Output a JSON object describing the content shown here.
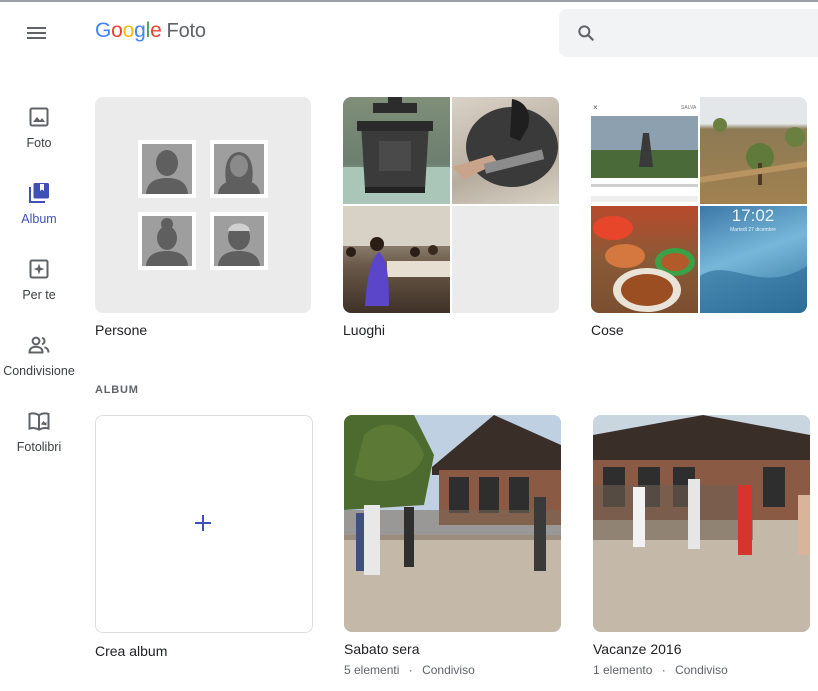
{
  "app": {
    "logo_word": "Google",
    "product": "Foto"
  },
  "header": {
    "menu_icon": "hamburger-menu-icon",
    "search_icon": "search-icon"
  },
  "sidebar": {
    "items": [
      {
        "label": "Foto",
        "icon": "photo-icon"
      },
      {
        "label": "Album",
        "icon": "album-icon",
        "active": true
      },
      {
        "label": "Per te",
        "icon": "assistant-icon"
      },
      {
        "label": "Condivisione",
        "icon": "sharing-icon"
      },
      {
        "label": "Fotolibri",
        "icon": "photobook-icon"
      }
    ]
  },
  "categories": [
    {
      "label": "Persone"
    },
    {
      "label": "Luoghi"
    },
    {
      "label": "Cose"
    }
  ],
  "things_thumb_text": {
    "time": "17:02",
    "date": "Martedì 27 dicembre",
    "salva": "SALVA"
  },
  "albums_section": {
    "title": "ALBUM"
  },
  "create_album": {
    "label": "Crea album"
  },
  "albums": [
    {
      "title": "Sabato sera",
      "count": "5 elementi",
      "separator": "·",
      "status": "Condiviso"
    },
    {
      "title": "Vacanze 2016",
      "count": "1 elemento",
      "separator": "·",
      "status": "Condiviso"
    }
  ],
  "colors": {
    "accent": "#3f51b5",
    "muted": "#5f6368",
    "placeholder_tile": "#ebebeb",
    "search_bg": "#f1f3f4"
  }
}
